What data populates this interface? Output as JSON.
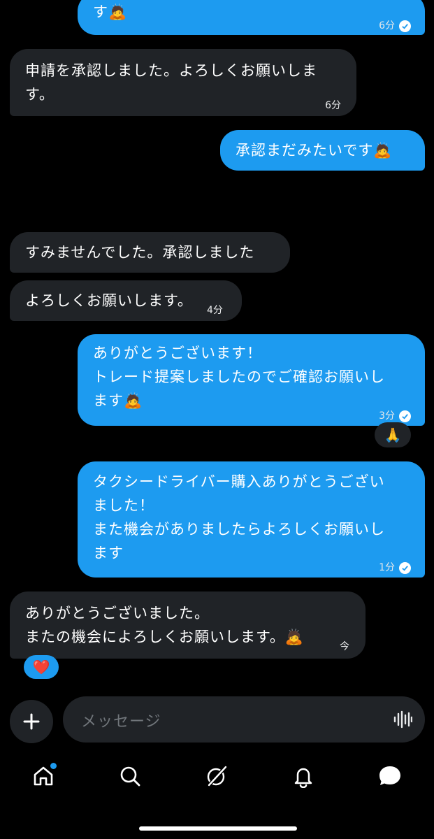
{
  "messages": [
    {
      "id": "m1",
      "side": "sent",
      "lines": [
        "す🙇"
      ],
      "time": "6分",
      "read": true
    },
    {
      "id": "m2",
      "side": "recv",
      "lines": [
        "申請を承認しました。よろしくお願いしま",
        "す。"
      ],
      "time": "6分"
    },
    {
      "id": "m3",
      "side": "sent",
      "lines": [
        "承認まだみたいです🙇"
      ]
    },
    {
      "id": "m4",
      "side": "recv",
      "lines": [
        "すみませんでした。承認しました"
      ]
    },
    {
      "id": "m5",
      "side": "recv",
      "lines": [
        "よろしくお願いします。"
      ],
      "time": "4分"
    },
    {
      "id": "m6",
      "side": "sent",
      "lines": [
        "ありがとうございます！",
        "トレード提案しましたのでご確認お願いし",
        "ます🙇"
      ],
      "time": "3分",
      "read": true,
      "reaction": "🙏"
    },
    {
      "id": "m7",
      "side": "sent",
      "lines": [
        "タクシードライバー購入ありがとうござい",
        "ました！",
        "また機会がありましたらよろしくお願いし",
        "ます"
      ],
      "time": "1分",
      "read": true
    },
    {
      "id": "m8",
      "side": "recv",
      "lines": [
        "ありがとうございました。",
        "またの機会によろしくお願いします。🙇"
      ],
      "time": "今",
      "reaction": "❤️"
    }
  ],
  "composer": {
    "placeholder": "メッセージ"
  },
  "nav": {
    "items": [
      {
        "name": "home",
        "badge": true
      },
      {
        "name": "search"
      },
      {
        "name": "grok"
      },
      {
        "name": "notifications"
      },
      {
        "name": "messages",
        "active": true
      }
    ]
  },
  "colors": {
    "sent_bubble": "#1d9bf0",
    "recv_bubble": "#202327",
    "background": "#000000"
  }
}
